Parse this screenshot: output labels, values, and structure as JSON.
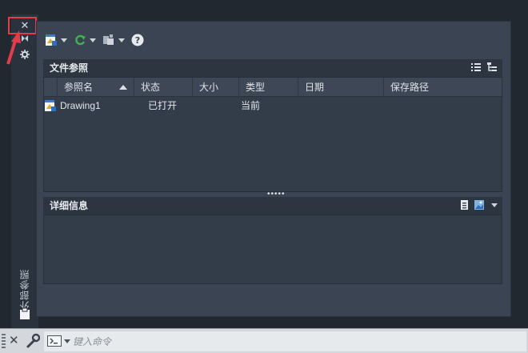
{
  "strip": {
    "title": "外部参照"
  },
  "section_xref": {
    "title": "文件参照"
  },
  "columns": [
    "参照名",
    "状态",
    "大小",
    "类型",
    "日期",
    "保存路径"
  ],
  "rows": [
    {
      "name": "Drawing1",
      "status": "已打开",
      "size": "",
      "type": "当前",
      "date": "",
      "path": ""
    }
  ],
  "section_details": {
    "title": "详细信息"
  },
  "command": {
    "placeholder": "键入命令"
  },
  "colors": {
    "panel": "#3b4452",
    "background": "#212830",
    "highlight": "#e23b4a",
    "refresh": "#3cb54a"
  },
  "icons": [
    "close-icon",
    "pin-icon",
    "settings-icon",
    "attach-dwg-icon",
    "refresh-icon",
    "change-path-icon",
    "help-icon",
    "list-view-icon",
    "tree-view-icon",
    "details-icon",
    "preview-icon",
    "clipboard-icon",
    "wrench-icon",
    "command-prompt-icon"
  ]
}
